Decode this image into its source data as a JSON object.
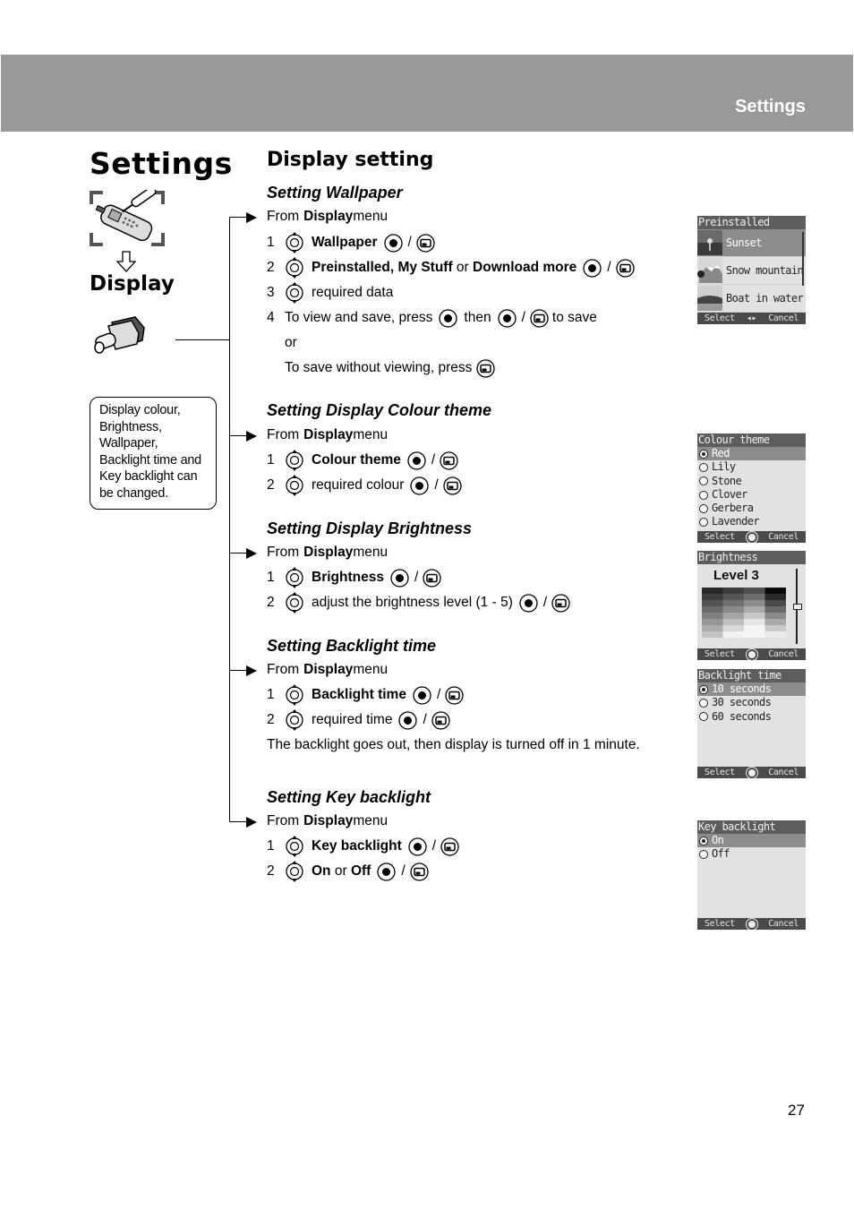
{
  "header": {
    "section_title": "Settings"
  },
  "left_panel": {
    "title": "Settings",
    "subtitle": "Display",
    "info_box_lines": [
      "Display colour,",
      "Brightness,",
      "Wallpaper,",
      "Backlight time and",
      "Key backlight can",
      "be changed."
    ]
  },
  "main": {
    "heading": "Display setting",
    "sections": [
      {
        "heading": "Setting Wallpaper",
        "from": {
          "prefix": "From ",
          "bold": "Display",
          "suffix": " menu"
        },
        "steps": [
          {
            "num": "1",
            "bold": "Wallpaper"
          },
          {
            "num": "2",
            "bold1": "Preinstalled, My Stuff",
            "mid": " or ",
            "bold2": "Download more"
          },
          {
            "num": "3",
            "text": "required data"
          },
          {
            "num": "4",
            "text1": "To view and save, press",
            "text2": "then",
            "text3": "to save"
          }
        ],
        "or": "or",
        "alt": "To save without viewing, press"
      },
      {
        "heading": "Setting Display Colour theme",
        "from": {
          "prefix": "From ",
          "bold": "Display",
          "suffix": " menu"
        },
        "steps": [
          {
            "num": "1",
            "bold": "Colour theme"
          },
          {
            "num": "2",
            "text": "required colour"
          }
        ]
      },
      {
        "heading": "Setting Display Brightness",
        "from": {
          "prefix": "From ",
          "bold": "Display",
          "suffix": " menu"
        },
        "steps": [
          {
            "num": "1",
            "bold": "Brightness"
          },
          {
            "num": "2",
            "text": "adjust the brightness level (1 - 5)"
          }
        ]
      },
      {
        "heading": "Setting Backlight time",
        "from": {
          "prefix": "From ",
          "bold": "Display",
          "suffix": " menu"
        },
        "steps": [
          {
            "num": "1",
            "bold": "Backlight time"
          },
          {
            "num": "2",
            "text": "required time"
          }
        ],
        "note": "The backlight goes out, then display is turned off in 1 minute."
      },
      {
        "heading": "Setting Key backlight",
        "from": {
          "prefix": "From ",
          "bold": "Display",
          "suffix": " menu"
        },
        "steps": [
          {
            "num": "1",
            "bold": "Key backlight"
          },
          {
            "num": "2",
            "bold1": "On",
            "mid": " or ",
            "bold2": "Off"
          }
        ]
      }
    ],
    "slash": "/"
  },
  "screens": {
    "wallpaper": {
      "title": "Preinstalled",
      "items": [
        "Sunset",
        "Snow mountain",
        "Boat in water"
      ],
      "selected_index": 0,
      "softkey_left": "Select",
      "softkey_center": "◂▸",
      "softkey_right": "Cancel"
    },
    "colour_theme": {
      "title": "Colour theme",
      "options": [
        "Red",
        "Lily",
        "Stone",
        "Clover",
        "Gerbera",
        "Lavender"
      ],
      "selected_index": 0,
      "softkey_left": "Select",
      "softkey_right": "Cancel"
    },
    "brightness": {
      "title": "Brightness",
      "level_label": "Level 3",
      "level": 3,
      "level_max": 5,
      "softkey_left": "Select",
      "softkey_right": "Cancel"
    },
    "backlight_time": {
      "title": "Backlight time",
      "options": [
        "10 seconds",
        "30 seconds",
        "60 seconds"
      ],
      "selected_index": 0,
      "softkey_left": "Select",
      "softkey_right": "Cancel"
    },
    "key_backlight": {
      "title": "Key backlight",
      "options": [
        "On",
        "Off"
      ],
      "selected_index": 0,
      "softkey_left": "Select",
      "softkey_right": "Cancel"
    }
  },
  "footer": {
    "page_number": "27"
  }
}
